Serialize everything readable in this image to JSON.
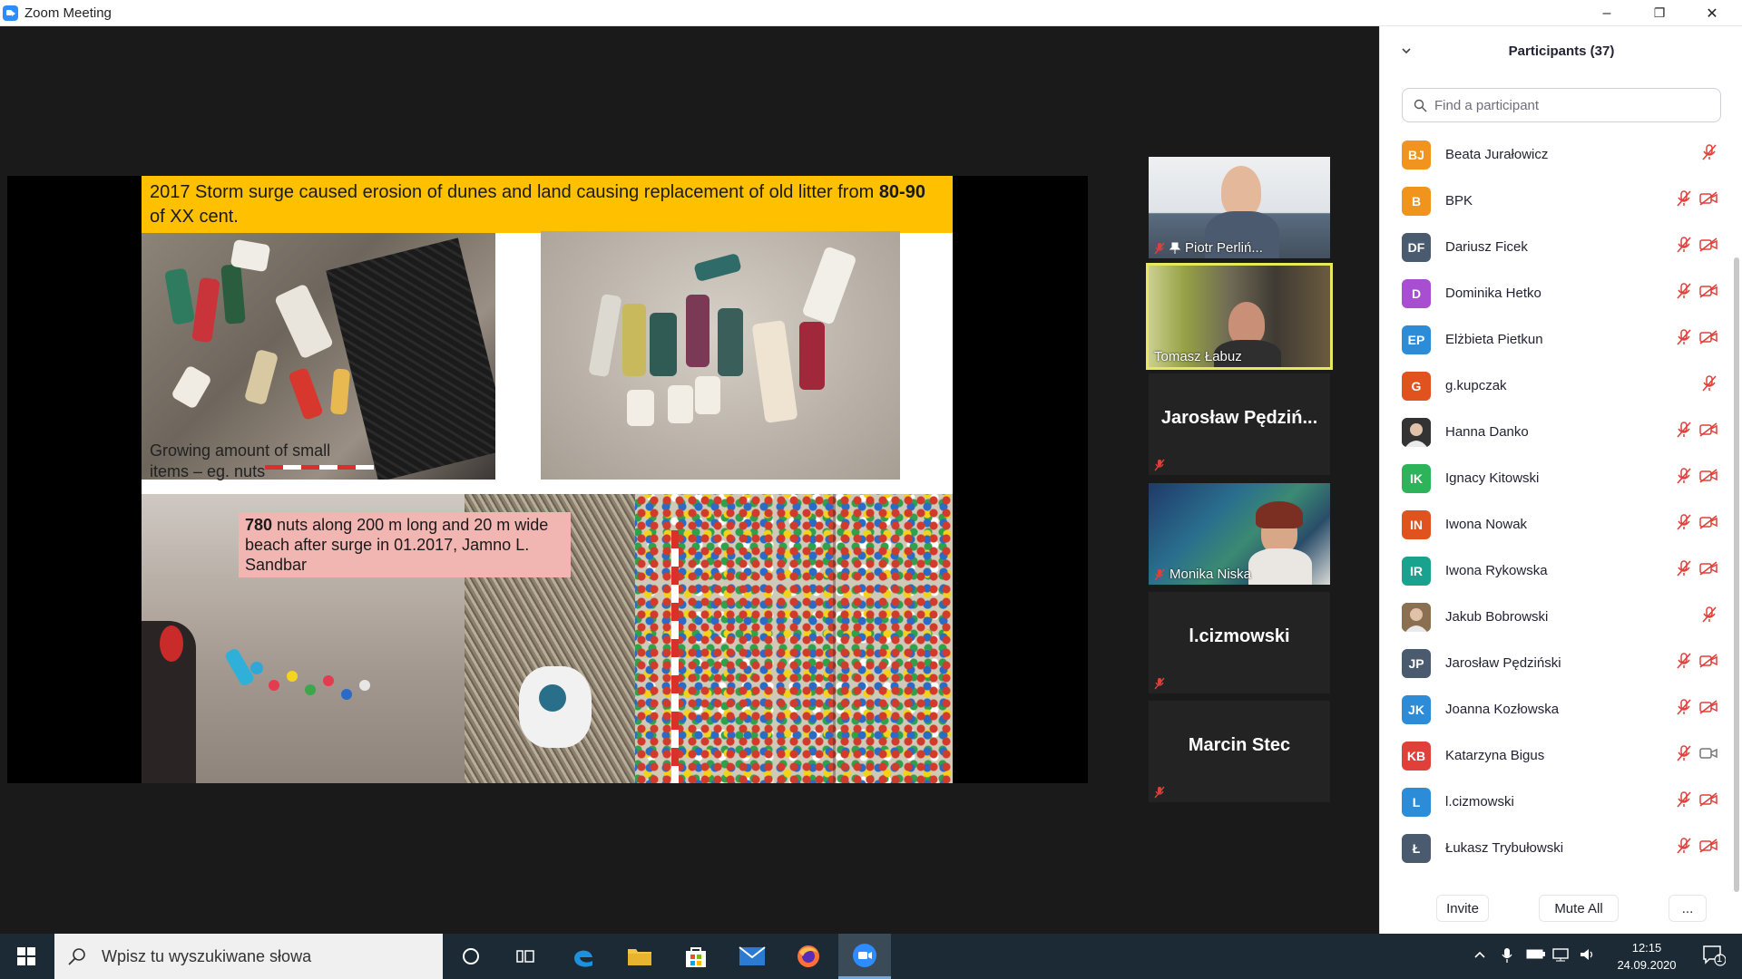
{
  "window": {
    "title": "Zoom Meeting",
    "controls": {
      "minimize": "–",
      "restore": "❐",
      "close": "✕"
    }
  },
  "slide": {
    "banner_text_1": "2017 Storm surge caused erosion of dunes and land causing replacement of old litter from ",
    "banner_bold": "80-90",
    "banner_text_2": " of XX cent.",
    "growing_line1": "Growing amount of small",
    "growing_line2": "items – eg. nuts",
    "callout_bold": "780",
    "callout_text": " nuts along 200 m long and 20 m wide beach after surge in 01.2017, Jamno L. Sandbar"
  },
  "video_tiles": [
    {
      "name": "Piotr Perliń...",
      "muted": true,
      "pinned": true,
      "has_video": true
    },
    {
      "name": "Tomasz Łabuz",
      "muted": false,
      "active_speaker": true,
      "has_video": true
    },
    {
      "name": "Jarosław  Pędziń...",
      "muted": true,
      "has_video": false
    },
    {
      "name": "Monika Niska",
      "muted": true,
      "has_video": true
    },
    {
      "name": "l.cizmowski",
      "muted": true,
      "has_video": false
    },
    {
      "name": "Marcin Stec",
      "muted": true,
      "has_video": false
    }
  ],
  "participants_panel": {
    "title": "Participants (37)",
    "search_placeholder": "Find a participant",
    "participants": [
      {
        "initials": "BJ",
        "name": "Beata Jurałowicz",
        "color": "#f0941d",
        "mic_muted": true,
        "video_off": false,
        "show_video_icon": false
      },
      {
        "initials": "B",
        "name": "BPK",
        "color": "#f0941d",
        "mic_muted": true,
        "video_off": true,
        "show_video_icon": true
      },
      {
        "initials": "DF",
        "name": "Dariusz Ficek",
        "color": "#4a5a6f",
        "mic_muted": true,
        "video_off": true,
        "show_video_icon": true
      },
      {
        "initials": "D",
        "name": "Dominika Hetko",
        "color": "#a84fd1",
        "mic_muted": true,
        "video_off": true,
        "show_video_icon": true
      },
      {
        "initials": "EP",
        "name": "Elżbieta Pietkun",
        "color": "#2d8cd8",
        "mic_muted": true,
        "video_off": true,
        "show_video_icon": true
      },
      {
        "initials": "G",
        "name": "g.kupczak",
        "color": "#e0521e",
        "mic_muted": true,
        "video_off": false,
        "show_video_icon": false
      },
      {
        "initials": "",
        "name": "Hanna Danko",
        "color": "#333333",
        "mic_muted": true,
        "video_off": true,
        "show_video_icon": true,
        "photo": true
      },
      {
        "initials": "IK",
        "name": "Ignacy Kitowski",
        "color": "#2db35a",
        "mic_muted": true,
        "video_off": true,
        "show_video_icon": true
      },
      {
        "initials": "IN",
        "name": "Iwona Nowak",
        "color": "#e0521e",
        "mic_muted": true,
        "video_off": true,
        "show_video_icon": true
      },
      {
        "initials": "IR",
        "name": "Iwona Rykowska",
        "color": "#19a38e",
        "mic_muted": true,
        "video_off": true,
        "show_video_icon": true
      },
      {
        "initials": "",
        "name": "Jakub Bobrowski",
        "color": "#8a7050",
        "mic_muted": true,
        "video_off": false,
        "show_video_icon": false,
        "photo": true
      },
      {
        "initials": "JP",
        "name": "Jarosław Pędziński",
        "color": "#4a5a6f",
        "mic_muted": true,
        "video_off": true,
        "show_video_icon": true
      },
      {
        "initials": "JK",
        "name": "Joanna Kozłowska",
        "color": "#2d8cd8",
        "mic_muted": true,
        "video_off": true,
        "show_video_icon": true
      },
      {
        "initials": "KB",
        "name": "Katarzyna Bigus",
        "color": "#e0403a",
        "mic_muted": true,
        "video_off": false,
        "show_video_icon": true
      },
      {
        "initials": "L",
        "name": "l.cizmowski",
        "color": "#2d8cd8",
        "mic_muted": true,
        "video_off": true,
        "show_video_icon": true
      },
      {
        "initials": "Ł",
        "name": "Łukasz Trybułowski",
        "color": "#4a5a6f",
        "mic_muted": true,
        "video_off": true,
        "show_video_icon": true
      }
    ],
    "buttons": {
      "invite": "Invite",
      "mute_all": "Mute All",
      "more": "..."
    }
  },
  "taskbar": {
    "search_placeholder": "Wpisz tu wyszukiwane słowa",
    "time": "12:15",
    "date": "24.09.2020",
    "notification_count": "1"
  }
}
